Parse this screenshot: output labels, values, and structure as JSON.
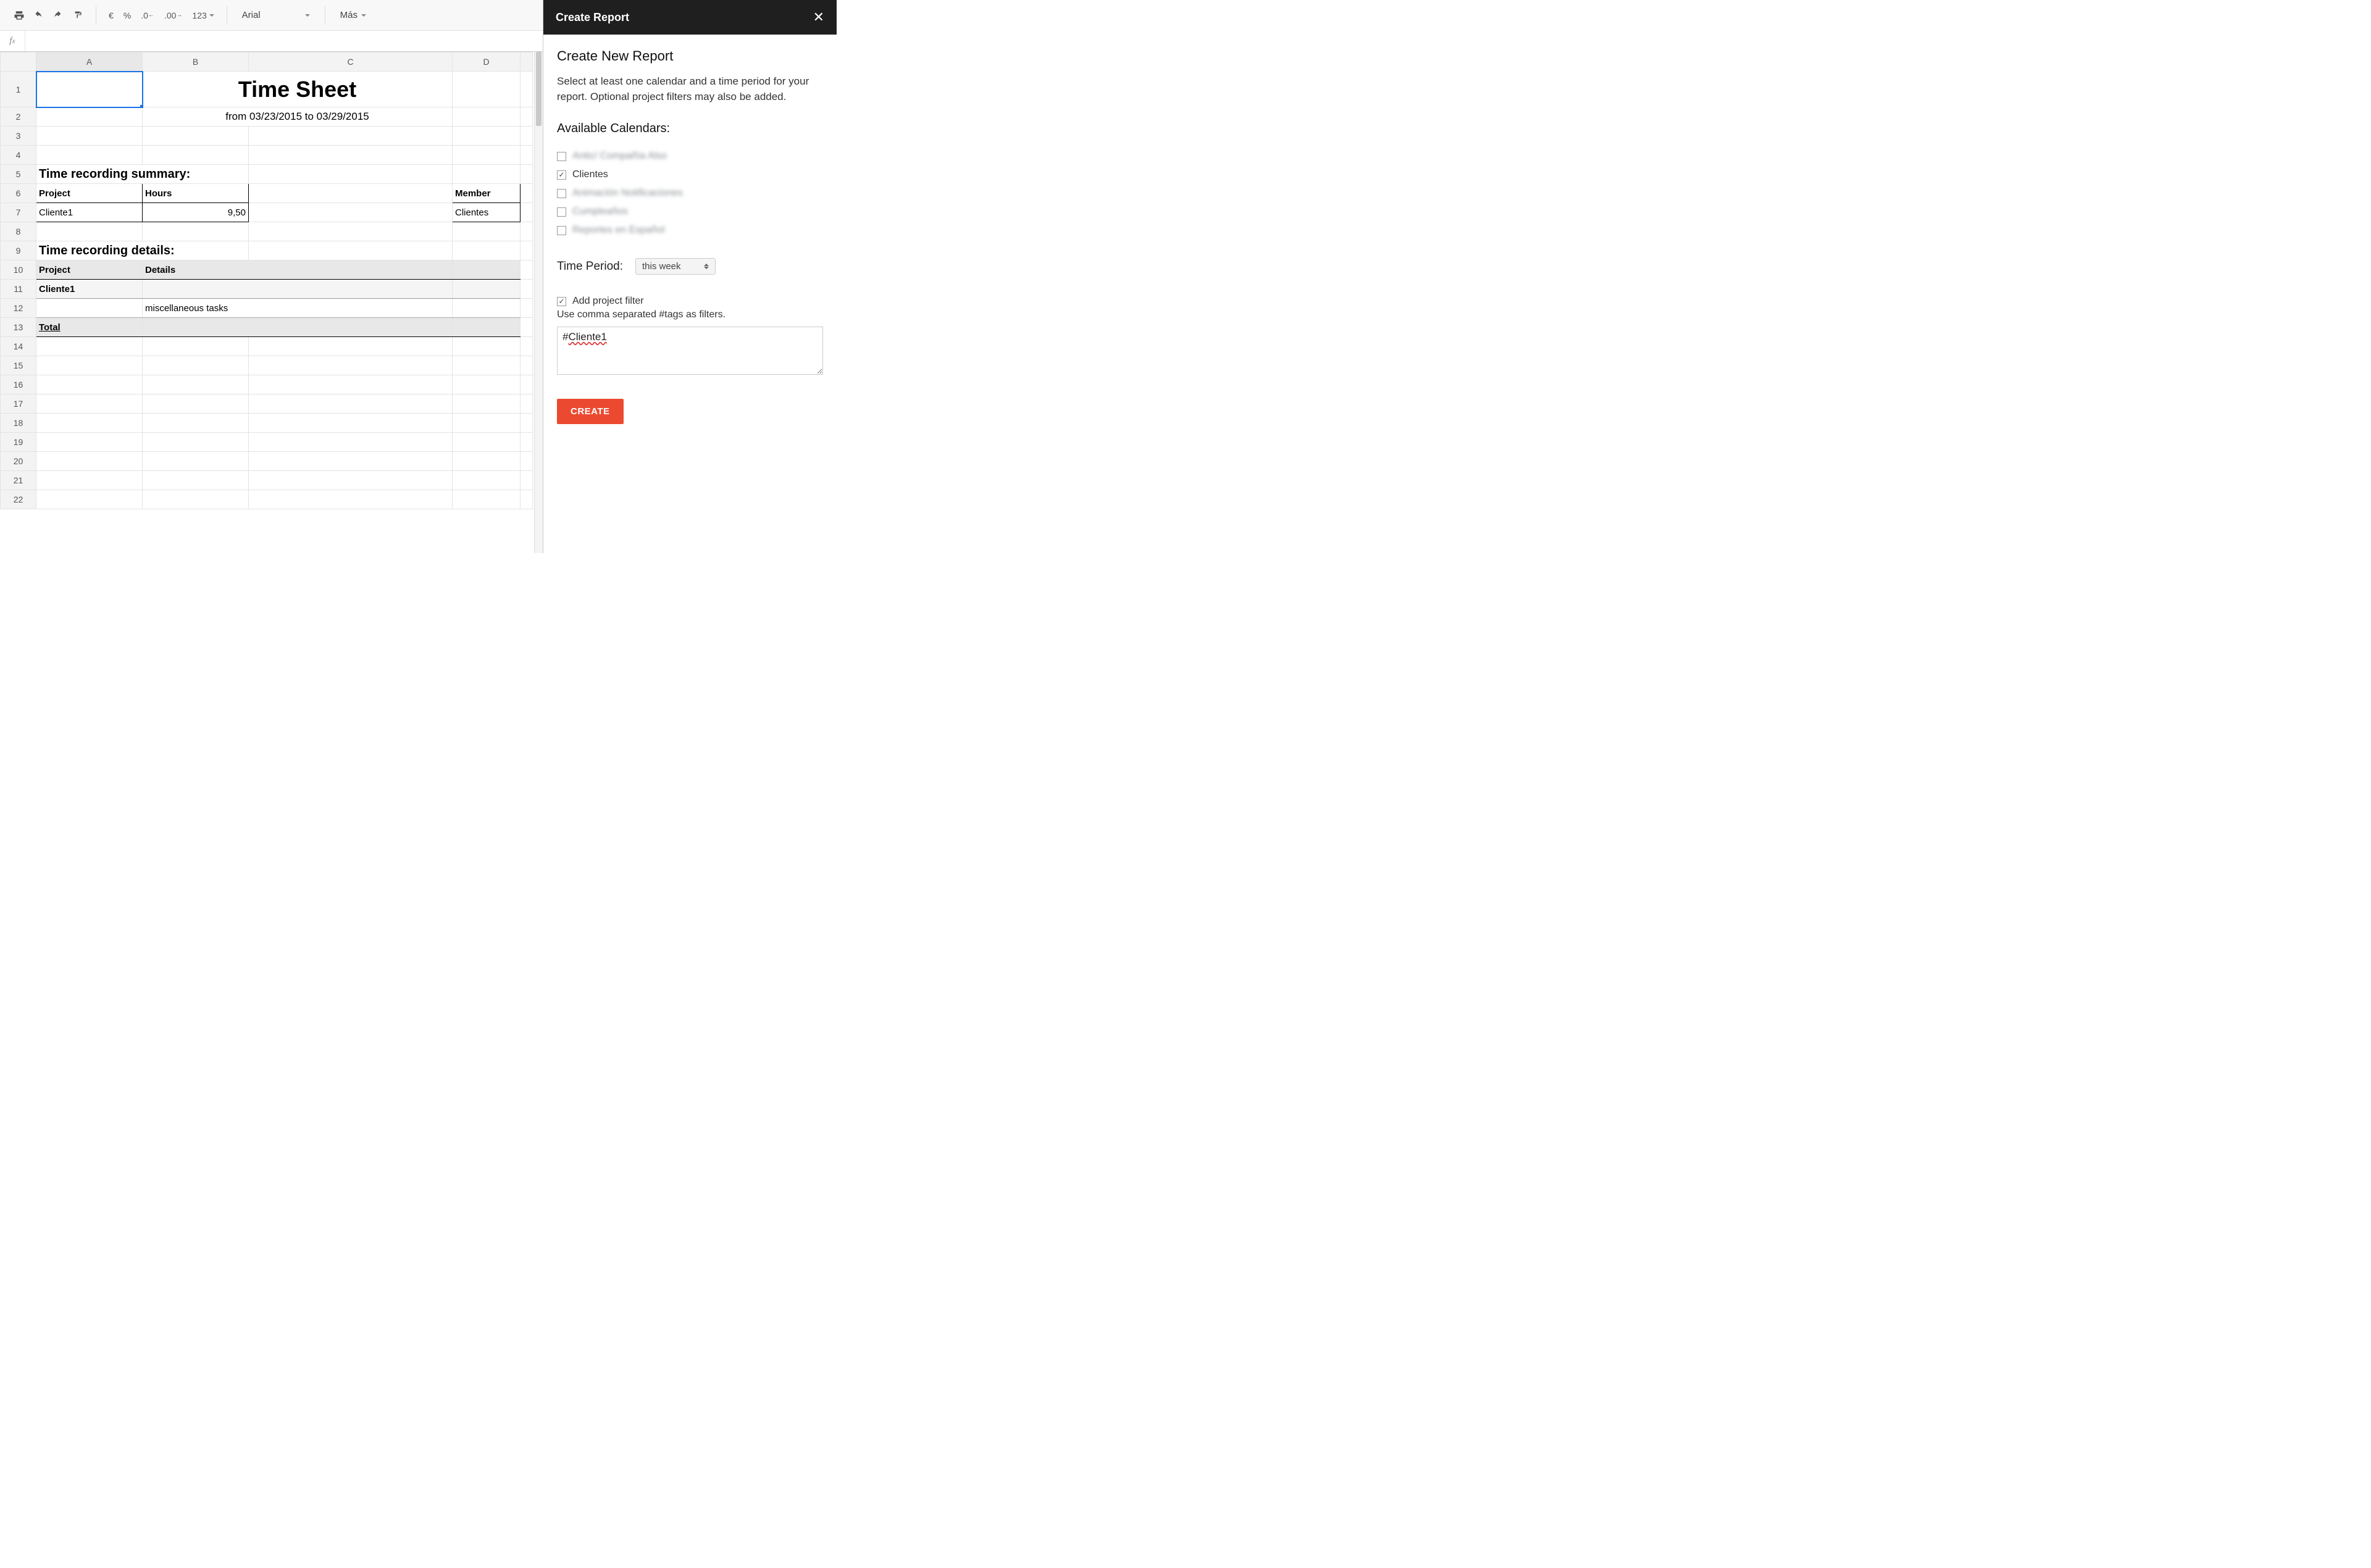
{
  "toolbar": {
    "currency": "€",
    "percent": "%",
    "dec_less": ".0",
    "dec_more": ".00",
    "numfmt": "123",
    "font": "Arial",
    "more": "Más"
  },
  "formula_bar": {
    "label": "fx",
    "value": ""
  },
  "columns": [
    "A",
    "B",
    "C",
    "D"
  ],
  "rows": [
    1,
    2,
    3,
    4,
    5,
    6,
    7,
    8,
    9,
    10,
    11,
    12,
    13,
    14,
    15,
    16,
    17,
    18,
    19,
    20,
    21,
    22
  ],
  "sheet": {
    "title": "Time Sheet",
    "subtitle": "from 03/23/2015 to 03/29/2015",
    "summary_heading": "Time recording summary:",
    "summary_headers": {
      "project": "Project",
      "hours": "Hours",
      "member": "Member"
    },
    "summary_row": {
      "project": "Cliente1",
      "hours": "9,50",
      "member": "Clientes"
    },
    "details_heading": "Time recording details:",
    "details_headers": {
      "project": "Project",
      "details": "Details"
    },
    "details_sub": "Cliente1",
    "details_row": "miscellaneous tasks",
    "details_total": "Total"
  },
  "panel": {
    "title": "Create Report",
    "heading": "Create New Report",
    "intro": "Select at least one calendar and a time period for your report. Optional project filters may also be added.",
    "calendars_label": "Available Calendars:",
    "calendars": [
      {
        "label": "Antic/ Compañía Also",
        "checked": false,
        "blur": true
      },
      {
        "label": "Clientes",
        "checked": true,
        "blur": false
      },
      {
        "label": "Animación Notificaciones",
        "checked": false,
        "blur": true
      },
      {
        "label": "Cumpleaños",
        "checked": false,
        "blur": true
      },
      {
        "label": "Reportes en Español",
        "checked": false,
        "blur": true
      }
    ],
    "time_label": "Time Period:",
    "time_value": "this week",
    "filter_check_label": "Add project filter",
    "filter_checked": true,
    "filter_hint": "Use comma separated #tags as filters.",
    "filter_value": "#Cliente1",
    "create_label": "CREATE"
  }
}
